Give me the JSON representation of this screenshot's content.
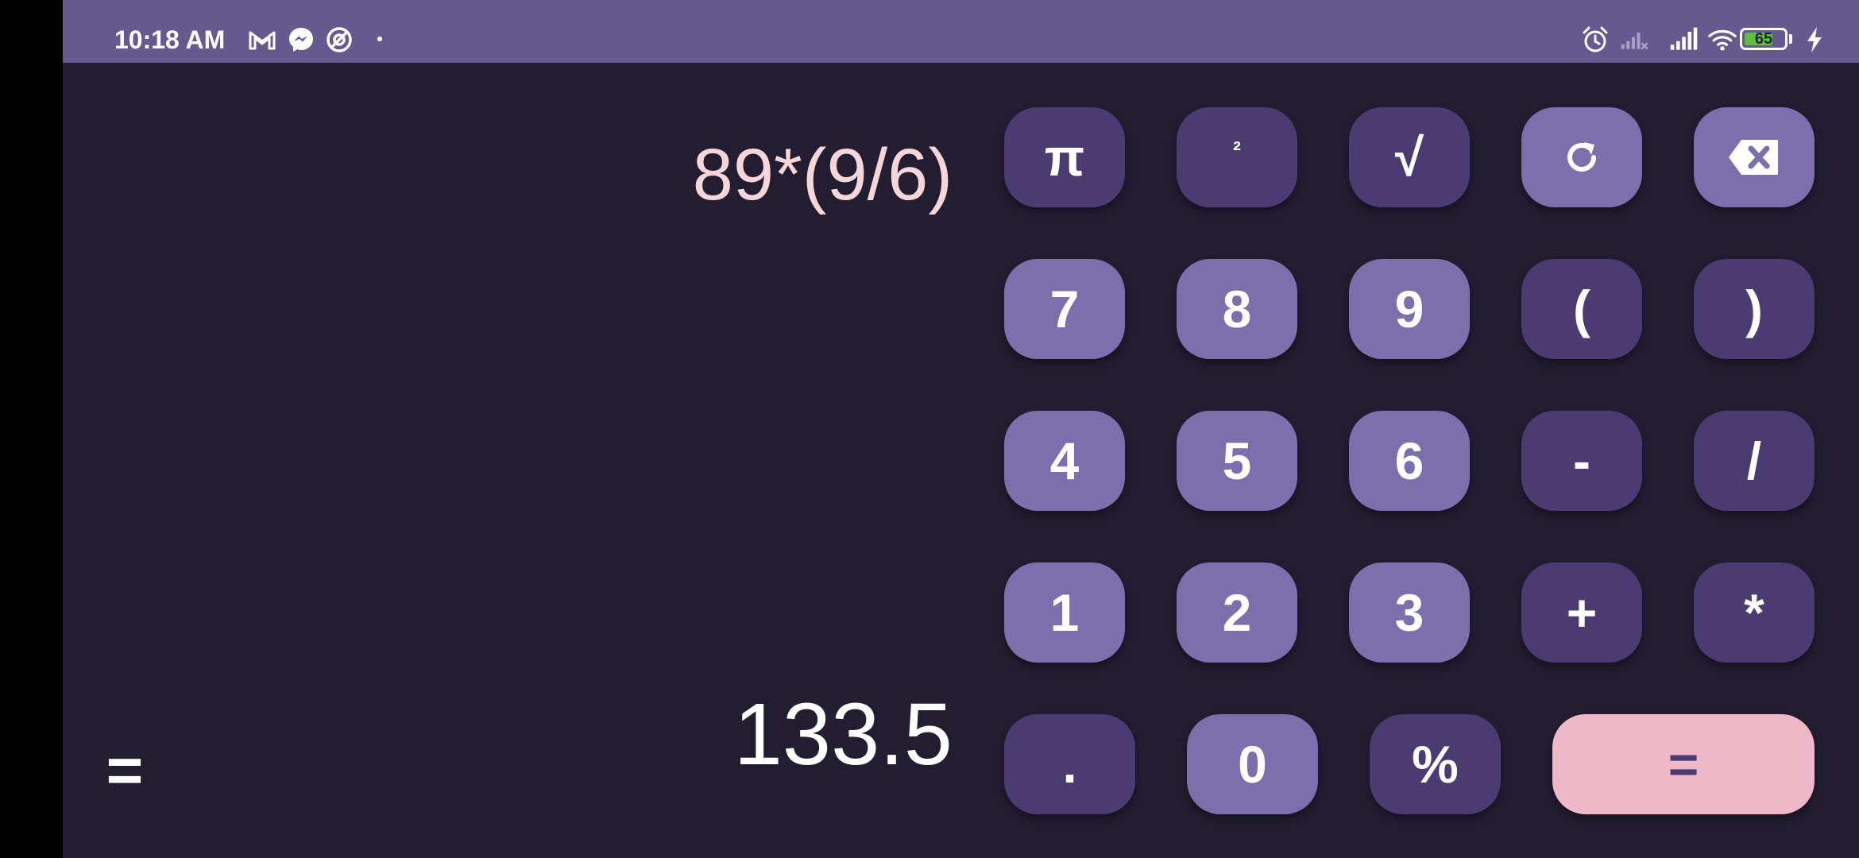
{
  "status_bar": {
    "time": "10:18 AM",
    "battery": "65",
    "notification_icons": [
      "gmail-icon",
      "messenger-icon",
      "screen-record-icon",
      "dot-icon"
    ],
    "system_icons": [
      "alarm-icon",
      "signal-no-service-icon",
      "signal-icon",
      "wifi-icon",
      "battery-icon",
      "charging-icon"
    ]
  },
  "display": {
    "expression": "89*(9/6)",
    "result": "133.5",
    "equals_label": "="
  },
  "keypad": {
    "pi": "π",
    "square": "²",
    "sqrt": "√",
    "k7": "7",
    "k8": "8",
    "k9": "9",
    "open_paren": "(",
    "close_paren": ")",
    "k4": "4",
    "k5": "5",
    "k6": "6",
    "minus": "-",
    "divide": "/",
    "k1": "1",
    "k2": "2",
    "k3": "3",
    "plus": "+",
    "multiply": "*",
    "dot": ".",
    "k0": "0",
    "percent": "%",
    "equals": "="
  },
  "colors": {
    "status_bar": "#665990",
    "background": "#221d31",
    "key_dark": "#4a3b73",
    "key_light": "#7d6fad",
    "key_accent": "#efb8c8",
    "expression_text": "#f6d6d8"
  }
}
